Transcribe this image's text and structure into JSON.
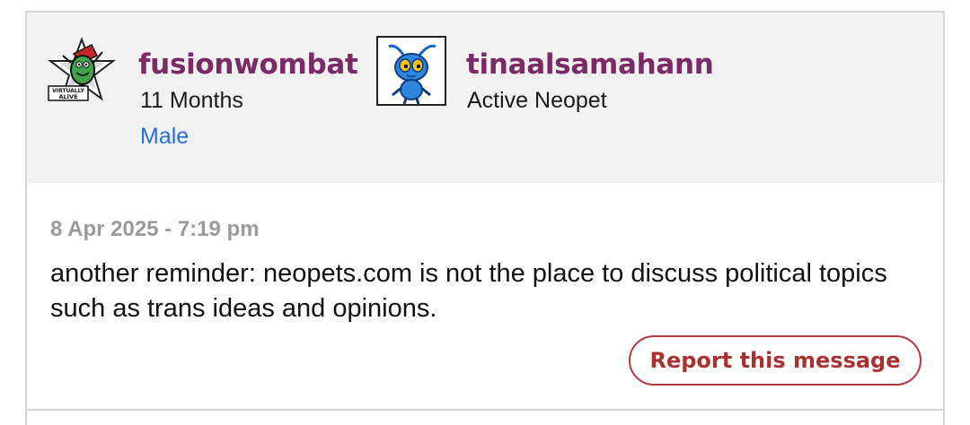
{
  "post": {
    "author": {
      "username": "fusionwombat",
      "account_age": "11 Months",
      "gender": "Male",
      "avatar_icon": "virtually-alive-avatar-icon",
      "avatar_text": "VIRTUALLY ALIVE"
    },
    "pet": {
      "name": "tinaalsamahann",
      "status": "Active Neopet",
      "image_icon": "blue-neopet-icon"
    },
    "timestamp": "8 Apr 2025 - 7:19 pm",
    "message": "another reminder: neopets.com is not the place to discuss political topics such as trans ideas and opinions.",
    "report_label": "Report this message"
  },
  "colors": {
    "username": "#7b2a66",
    "link": "#2a6fd6",
    "report": "#a83232",
    "header_bg": "#f1f1f1"
  }
}
